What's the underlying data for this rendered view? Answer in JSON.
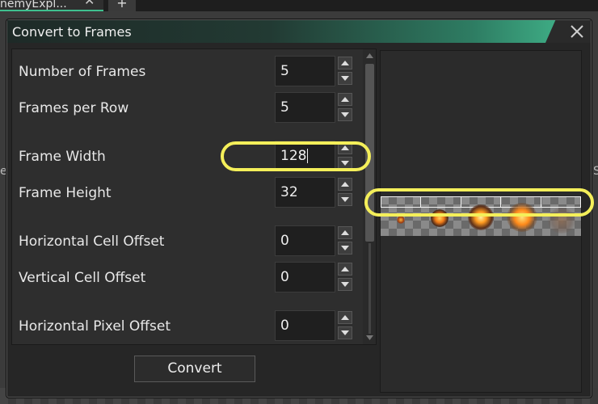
{
  "background": {
    "tab_label": "nemyExpl...",
    "tab_close": "✕",
    "add_tab": "+",
    "left_edge_text": "e",
    "right_edge_text": "S"
  },
  "dialog": {
    "title": "Convert to Frames",
    "convert_label": "Convert",
    "fields": [
      {
        "label": "Number of Frames",
        "value": "5"
      },
      {
        "label": "Frames per Row",
        "value": "5"
      },
      {
        "label": "Frame Width",
        "value": "128"
      },
      {
        "label": "Frame Height",
        "value": "32"
      },
      {
        "label": "Horizontal Cell Offset",
        "value": "0"
      },
      {
        "label": "Vertical Cell Offset",
        "value": "0"
      },
      {
        "label": "Horizontal Pixel Offset",
        "value": "0"
      }
    ]
  },
  "colors": {
    "highlight": "#f4ef5a",
    "title_accent": "#3fae86"
  }
}
